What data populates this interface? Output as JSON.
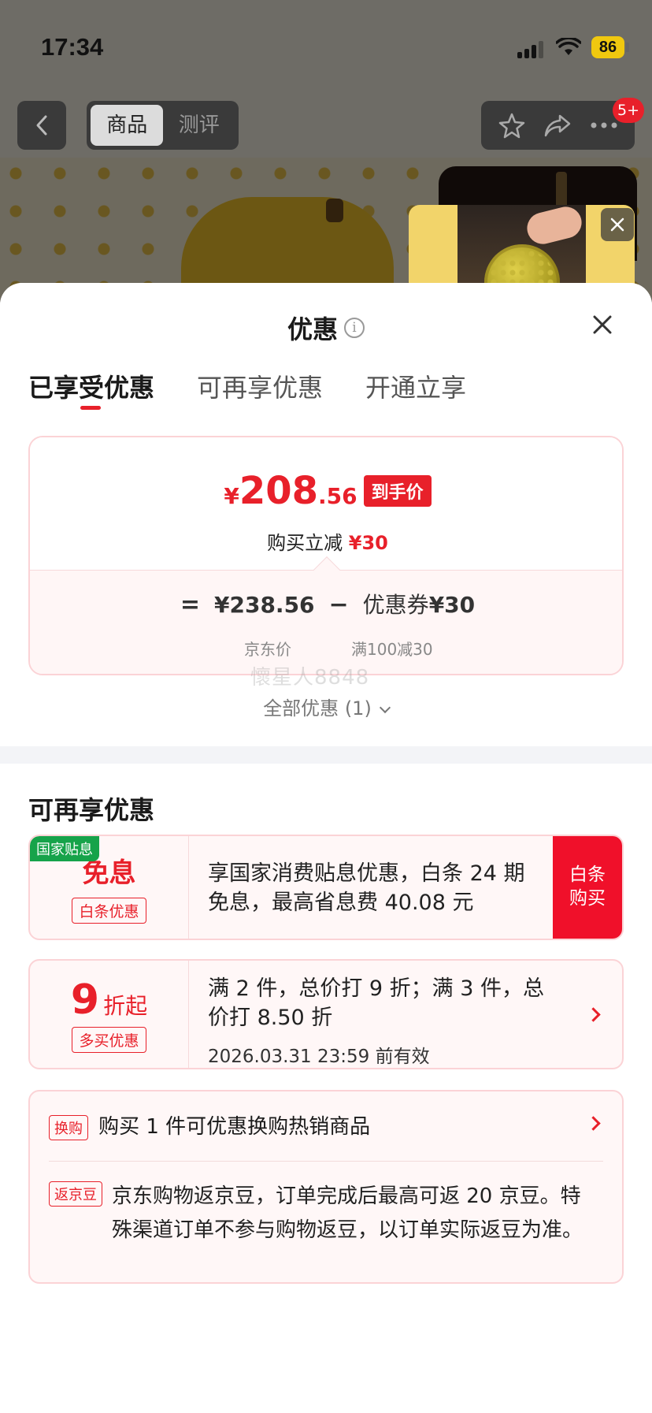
{
  "status_bar": {
    "time": "17:34",
    "battery": "86"
  },
  "nav": {
    "tabs": [
      "商品",
      "测评"
    ],
    "badge": "5+"
  },
  "sheet": {
    "title": "优惠",
    "tabs": [
      "已享受优惠",
      "可再享优惠",
      "开通立享"
    ],
    "summary": {
      "price_yen": "¥",
      "price_int": "208",
      "price_dec": ".56",
      "price_tag": "到手价",
      "reduce_label": "购买立减",
      "reduce_value": "¥30",
      "equals": "=",
      "jd_price": "¥238.56",
      "minus": "−",
      "coupon_label": "优惠券",
      "coupon_value": "¥30",
      "jd_price_label": "京东价",
      "coupon_condition": "满100减30"
    },
    "watermark": "懷星人8848",
    "all_offers": "全部优惠 (1)",
    "more_title": "可再享优惠",
    "cards": {
      "interest": {
        "corner": "国家贴息",
        "headline": "免息",
        "tag": "白条优惠",
        "text": "享国家消费贴息优惠，白条 24 期免息，最高省息费 40.08 元",
        "button": "白条购买"
      },
      "discount": {
        "num": "9",
        "unit": "折起",
        "tag": "多买优惠",
        "text": "满 2 件，总价打 9 折；满 3 件，总价打 8.50 折",
        "date": "2026.03.31 23:59 前有效"
      },
      "extras": {
        "swap_tag": "换购",
        "swap_text": "购买 1 件可优惠换购热销商品",
        "bean_tag": "返京豆",
        "bean_text": "京东购物返京豆，订单完成后最高可返 20 京豆。特殊渠道订单不参与购物返豆，以订单实际返豆为准。"
      }
    }
  },
  "colors": {
    "accent": "#e8202a",
    "green_tag": "#16a34a"
  }
}
